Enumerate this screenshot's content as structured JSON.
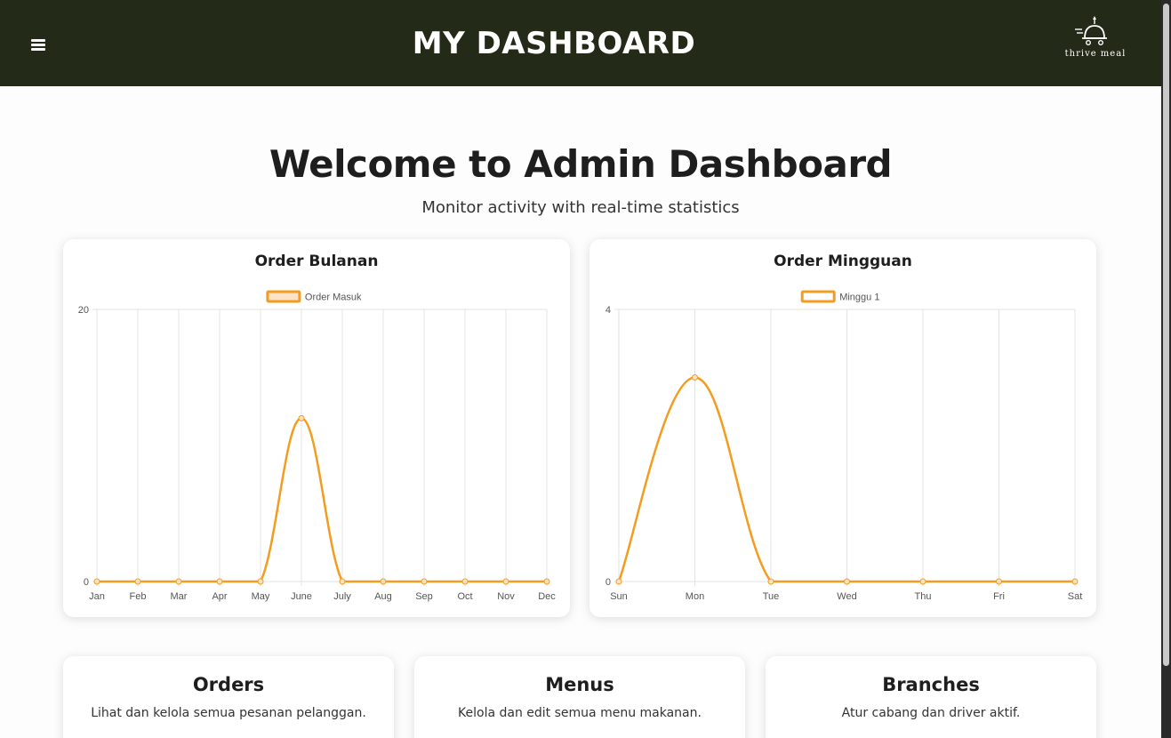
{
  "header": {
    "title": "MY DASHBOARD",
    "logo_text": "thrive meal",
    "background": "#232a17"
  },
  "welcome": {
    "title": "Welcome to Admin Dashboard",
    "subtitle": "Monitor activity with real-time statistics"
  },
  "chart_data": [
    {
      "card_title": "Order Bulanan",
      "type": "line",
      "categories": [
        "Jan",
        "Feb",
        "Mar",
        "Apr",
        "May",
        "June",
        "July",
        "Aug",
        "Sep",
        "Oct",
        "Nov",
        "Dec"
      ],
      "series": [
        {
          "name": "Order Masuk",
          "values": [
            0,
            0,
            0,
            0,
            0,
            12,
            0,
            0,
            0,
            0,
            0,
            0
          ],
          "color": "#f39c1f"
        }
      ],
      "ylim": [
        0,
        20
      ],
      "yticks": [
        0,
        20
      ],
      "grid": true,
      "legend": "top"
    },
    {
      "card_title": "Order Mingguan",
      "type": "line",
      "categories": [
        "Sun",
        "Mon",
        "Tue",
        "Wed",
        "Thu",
        "Fri",
        "Sat"
      ],
      "series": [
        {
          "name": "Minggu 1",
          "values": [
            0,
            3,
            0,
            0,
            0,
            0,
            0
          ],
          "color": "#f39c1f"
        }
      ],
      "ylim": [
        0,
        4
      ],
      "yticks": [
        0,
        4
      ],
      "grid": true,
      "legend": "top"
    }
  ],
  "cards": [
    {
      "title": "Orders",
      "description": "Lihat dan kelola semua pesanan pelanggan."
    },
    {
      "title": "Menus",
      "description": "Kelola dan edit semua menu makanan."
    },
    {
      "title": "Branches",
      "description": "Atur cabang dan driver aktif."
    }
  ]
}
